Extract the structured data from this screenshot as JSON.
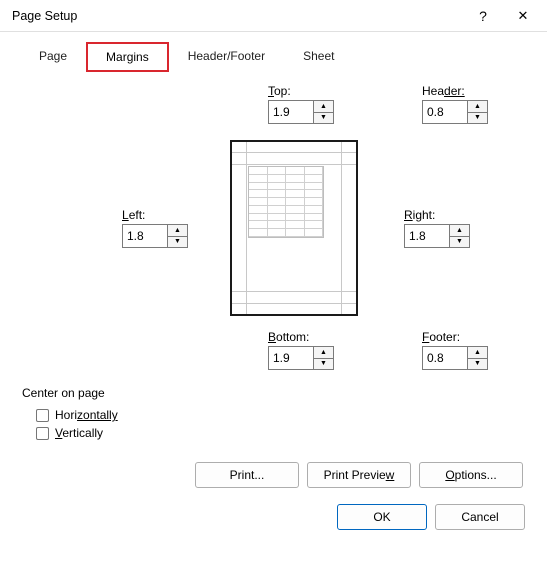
{
  "title": "Page Setup",
  "help_glyph": "?",
  "close_glyph": "✕",
  "tabs": {
    "page": "Page",
    "margins": "Margins",
    "header_footer": "Header/Footer",
    "sheet": "Sheet"
  },
  "labels": {
    "top_pre": "T",
    "top_post": "op:",
    "header_pre": "Hea",
    "header_post": "der:",
    "left_pre": "L",
    "left_post": "eft:",
    "right_pre": "R",
    "right_post": "ight:",
    "bottom_pre": "B",
    "bottom_post": "ottom:",
    "footer_pre": "F",
    "footer_post": "ooter:",
    "center_on_page": "Center on page",
    "horizontally_pre": "Hori",
    "horizontally_post": "zontally",
    "vertically_pre": "V",
    "vertically_post": "ertically"
  },
  "values": {
    "top": "1.9",
    "header": "0.8",
    "left": "1.8",
    "right": "1.8",
    "bottom": "1.9",
    "footer": "0.8"
  },
  "buttons": {
    "print": "Print...",
    "print_preview_pre": "Print Previe",
    "print_preview_post": "w",
    "options_pre": "O",
    "options_post": "ptions...",
    "ok": "OK",
    "cancel": "Cancel"
  },
  "spin": {
    "up": "▲",
    "down": "▼"
  }
}
